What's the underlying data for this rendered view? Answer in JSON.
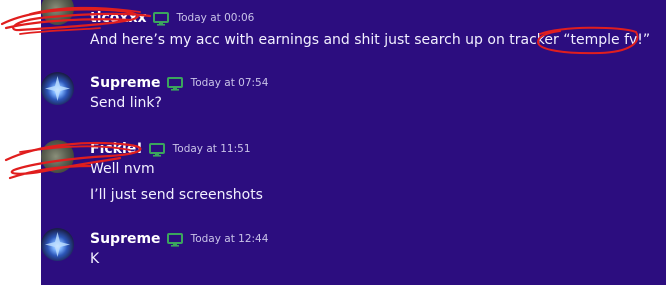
{
  "messages": [
    {
      "username": "ticoxxx",
      "timestamp": "Today at 00:06",
      "lines": [
        "And here’s my acc with earnings and shit just search up on tracker “temple fv!”"
      ]
    },
    {
      "username": "Supreme",
      "timestamp": "Today at 07:54",
      "lines": [
        "Send link?"
      ]
    },
    {
      "username": "Fickle!",
      "timestamp": "Today at 11:51",
      "lines": [
        "Well nvm",
        "I’ll just send screenshots"
      ]
    },
    {
      "username": "Supreme",
      "timestamp": "Today at 12:44",
      "lines": [
        "K"
      ]
    }
  ],
  "colors": {
    "chat_background": "#2c0d7f",
    "device_icon": "#3ba55d",
    "annotation_red": "#e01e1e"
  }
}
